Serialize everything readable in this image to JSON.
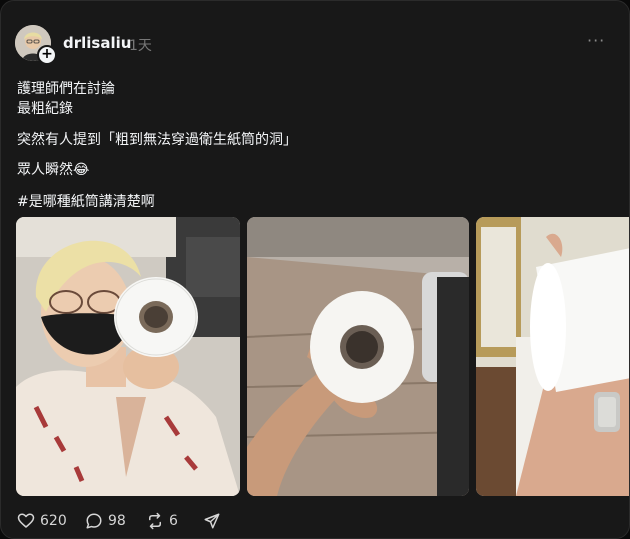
{
  "post": {
    "username": "drlisaliu",
    "time": "1天",
    "more_label": "···",
    "follow_label": "+",
    "lines": [
      "護理師們在討論",
      "最粗紀錄",
      "突然有人提到「粗到無法穿過衛生紙筒的洞」",
      "眾人瞬然😂",
      "#是哪種紙筒講清楚啊"
    ]
  },
  "media": [
    {
      "icon": "photo-woman-holding-toilet-paper"
    },
    {
      "icon": "photo-hand-holding-toilet-paper"
    },
    {
      "icon": "photo-toilet-paper-on-wrist"
    }
  ],
  "actions": {
    "likes": "620",
    "comments": "98",
    "reposts": "6"
  },
  "colors": {
    "background": "#181818",
    "text": "#f3f5f7",
    "muted": "#777777"
  }
}
